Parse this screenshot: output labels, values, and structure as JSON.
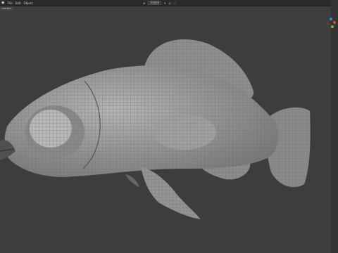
{
  "app": {
    "menu": [
      "File",
      "Edit",
      "Object"
    ],
    "view_mode": "Global",
    "tab_label": "Add Box"
  },
  "colors": {
    "background": "#3d3d3d",
    "mesh_base": "#9a9a9a",
    "wire": "#5a5a5a",
    "gizmo_x": "#e04a4a",
    "gizmo_y": "#6cbf3a",
    "gizmo_z": "#3a7ee0"
  },
  "icons": [
    "blender-logo-icon",
    "transform-global-icon",
    "snap-icon",
    "proportional-edit-icon"
  ]
}
